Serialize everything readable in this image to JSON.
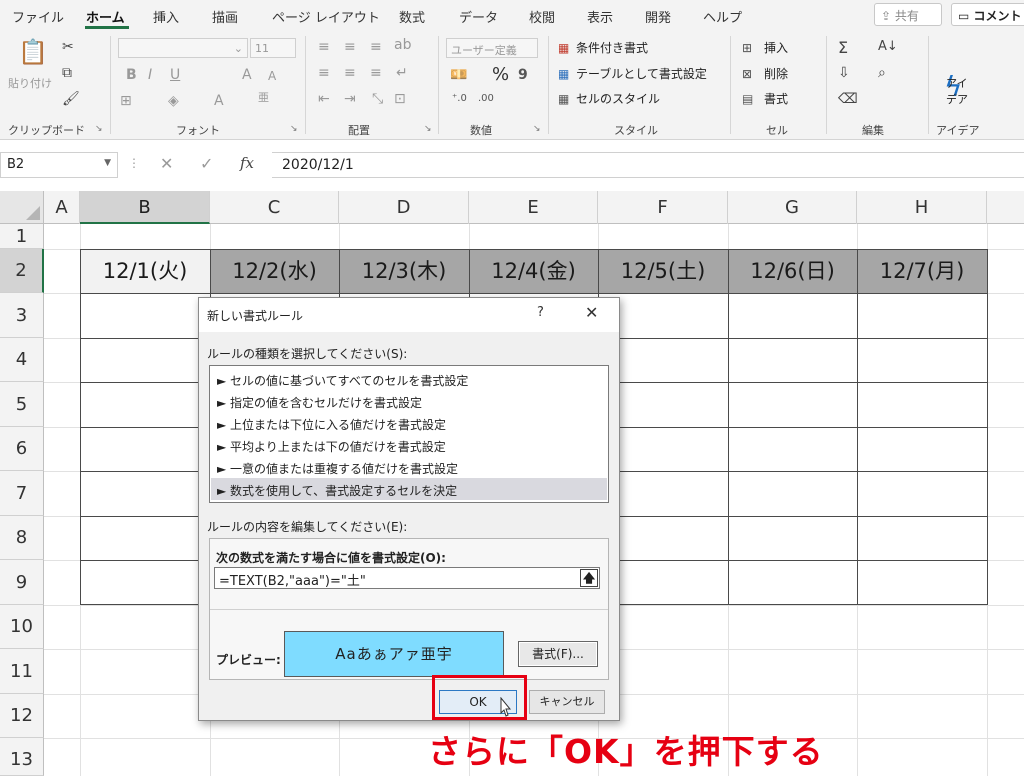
{
  "tabs": [
    {
      "label": "ファイル",
      "active": false
    },
    {
      "label": "ホーム",
      "active": true
    },
    {
      "label": "挿入",
      "active": false
    },
    {
      "label": "描画",
      "active": false
    },
    {
      "label": "ページ レイアウト",
      "active": false
    },
    {
      "label": "数式",
      "active": false
    },
    {
      "label": "データ",
      "active": false
    },
    {
      "label": "校閲",
      "active": false
    },
    {
      "label": "表示",
      "active": false
    },
    {
      "label": "開発",
      "active": false
    },
    {
      "label": "ヘルプ",
      "active": false
    }
  ],
  "share_label": "共有",
  "comment_label": "コメント",
  "ribbon": {
    "clipboard": {
      "group": "クリップボード",
      "paste": "貼り付け"
    },
    "font": {
      "group": "フォント",
      "font_size": "11"
    },
    "alignment": {
      "group": "配置"
    },
    "number": {
      "group": "数値",
      "format": "ユーザー定義",
      "percent": "%"
    },
    "styles": {
      "group": "スタイル",
      "conditional": "条件付き書式",
      "as_table": "テーブルとして書式設定",
      "cell_styles": "セルのスタイル"
    },
    "cells": {
      "group": "セル",
      "insert": "挿入",
      "delete": "削除",
      "format": "書式"
    },
    "editing": {
      "group": "編集"
    },
    "ideas": {
      "group": "アイデア",
      "label1": "アイ",
      "label2": "デア"
    }
  },
  "formula_bar": {
    "name_box": "B2",
    "value": "2020/12/1"
  },
  "columns": [
    "A",
    "B",
    "C",
    "D",
    "E",
    "F",
    "G",
    "H"
  ],
  "rows": [
    "1",
    "2",
    "3",
    "4",
    "5",
    "6",
    "7",
    "8",
    "9",
    "10",
    "11",
    "12",
    "13"
  ],
  "dates": [
    "12/1(火)",
    "12/2(水)",
    "12/3(木)",
    "12/4(金)",
    "12/5(土)",
    "12/6(日)",
    "12/7(月)"
  ],
  "dialog": {
    "title": "新しい書式ルール",
    "help": "?",
    "close": "✕",
    "rule_type_label": "ルールの種類を選択してください(S):",
    "rule_types": [
      "► セルの値に基づいてすべてのセルを書式設定",
      "► 指定の値を含むセルだけを書式設定",
      "► 上位または下位に入る値だけを書式設定",
      "► 平均より上または下の値だけを書式設定",
      "► 一意の値または重複する値だけを書式設定",
      "► 数式を使用して、書式設定するセルを決定"
    ],
    "selected_rule_index": 5,
    "edit_label": "ルールの内容を編集してください(E):",
    "formula_label": "次の数式を満たす場合に値を書式設定(O):",
    "formula": "=TEXT(B2,\"aaa\")=\"土\"",
    "preview_label": "プレビュー:",
    "preview_text": "Aaあぁアァ亜宇",
    "preview_color": "#7fdcff",
    "format_button": "書式(F)...",
    "ok": "OK",
    "cancel": "キャンセル"
  },
  "annotation": "さらに「OK」を押下する",
  "colors": {
    "accent": "#217346",
    "annotation": "#e60012",
    "header_fill": "#a6a6a6"
  }
}
